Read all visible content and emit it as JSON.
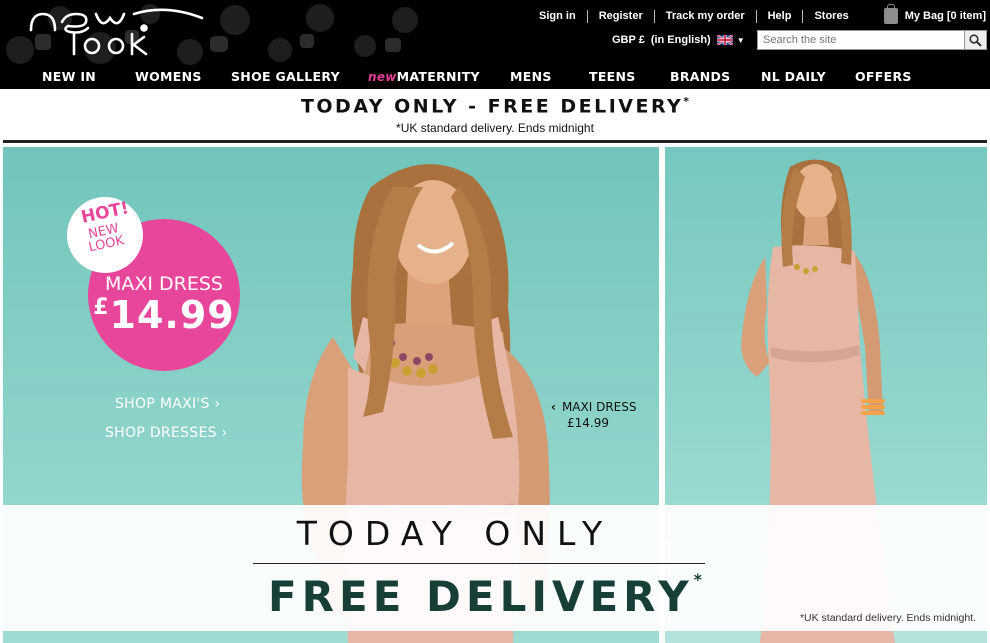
{
  "brand": {
    "logo_alt": "new look"
  },
  "utility": {
    "links": [
      "Sign in",
      "Register",
      "Track my order",
      "Help",
      "Stores"
    ],
    "bag_label": "My Bag [0 item]",
    "currency": "GBP £",
    "language": "(in English)",
    "search_placeholder": "Search the site"
  },
  "nav": {
    "items": [
      "NEW IN",
      "WOMENS",
      "SHOE GALLERY",
      "MATERNITY",
      "MENS",
      "TEENS",
      "BRANDS",
      "NL DAILY",
      "OFFERS"
    ],
    "maternity_tag": "new"
  },
  "promo": {
    "title": "TODAY ONLY - FREE DELIVERY",
    "asterisk": "*",
    "subtitle": "*UK standard delivery. Ends midnight"
  },
  "hero": {
    "badge": {
      "hot": "HOT!",
      "new_line1": "NEW",
      "new_line2": "LOOK",
      "title": "MAXI DRESS",
      "currency": "£",
      "price": "14.99"
    },
    "shop_maxis": "SHOP MAXI'S",
    "shop_dresses": "SHOP DRESSES",
    "caption_title": "MAXI DRESS",
    "caption_price": "£14.99",
    "overlay_title": "TODAY ONLY",
    "overlay_main": "FREE DELIVERY",
    "overlay_asterisk": "*",
    "overlay_note": "*UK standard delivery. Ends midnight."
  },
  "colors": {
    "accent_pink": "#e7469a",
    "teal_bg": "#8ed3ca",
    "delivery_green": "#173f38"
  }
}
